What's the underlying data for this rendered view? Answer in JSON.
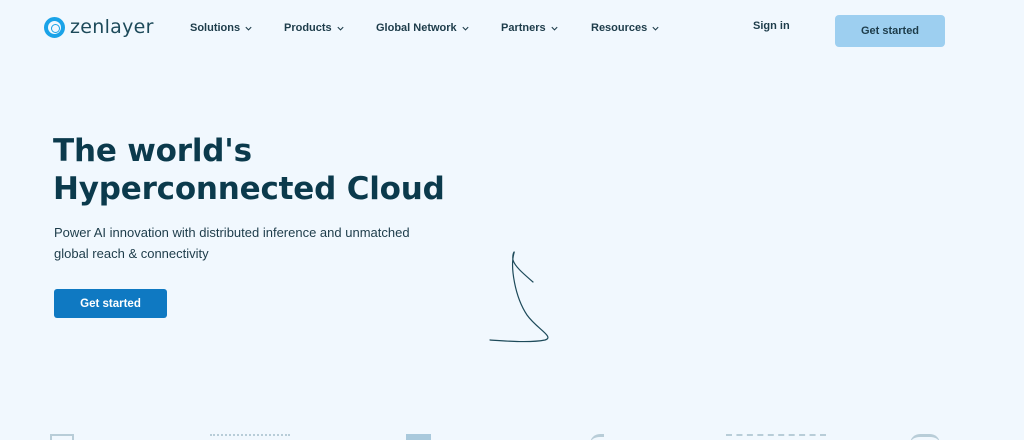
{
  "header": {
    "logo_text": "zenlayer",
    "nav": [
      {
        "label": "Solutions"
      },
      {
        "label": "Products"
      },
      {
        "label": "Global Network"
      },
      {
        "label": "Partners"
      },
      {
        "label": "Resources"
      }
    ],
    "sign_in": "Sign in",
    "cta": "Get started"
  },
  "hero": {
    "title_line1": "The world's",
    "title_line2": "Hyperconnected Cloud",
    "subtitle_line1": "Power AI innovation with distributed inference and unmatched",
    "subtitle_line2": "global reach & connectivity",
    "cta": "Get started"
  },
  "colors": {
    "background": "#f1f8fe",
    "accent": "#0f79c2",
    "header_cta": "#9dcff0",
    "logo_ring": "#1aa3e8",
    "heading": "#0b3a4c"
  },
  "icons": [
    "logo-ring-icon",
    "chevron-down-icon",
    "scribble-decoration"
  ]
}
